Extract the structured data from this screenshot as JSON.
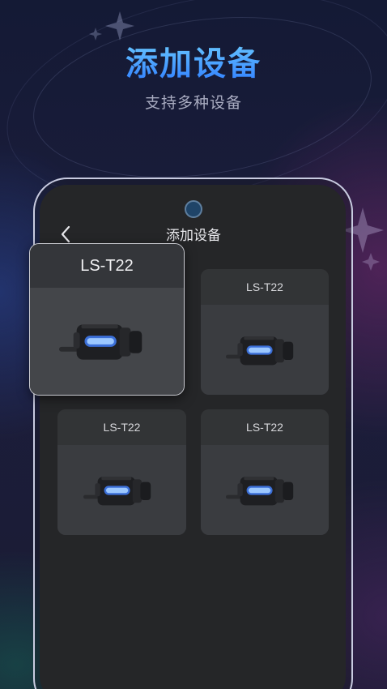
{
  "hero": {
    "title": "添加设备",
    "subtitle": "支持多种设备"
  },
  "app_screen": {
    "title": "添加设备",
    "back_icon": "chevron-left-icon"
  },
  "devices": [
    {
      "name": "LS-T22",
      "image": "device-camera-image",
      "selected": true
    },
    {
      "name": "LS-T22",
      "image": "device-camera-image",
      "selected": false
    },
    {
      "name": "LS-T22",
      "image": "device-camera-image",
      "selected": false
    },
    {
      "name": "LS-T22",
      "image": "device-camera-image",
      "selected": false
    }
  ],
  "colors": {
    "accent": "#3aa0ff",
    "screen_bg": "#252628",
    "card_bg": "#37393c",
    "device_glow": "#6aa8ff"
  }
}
